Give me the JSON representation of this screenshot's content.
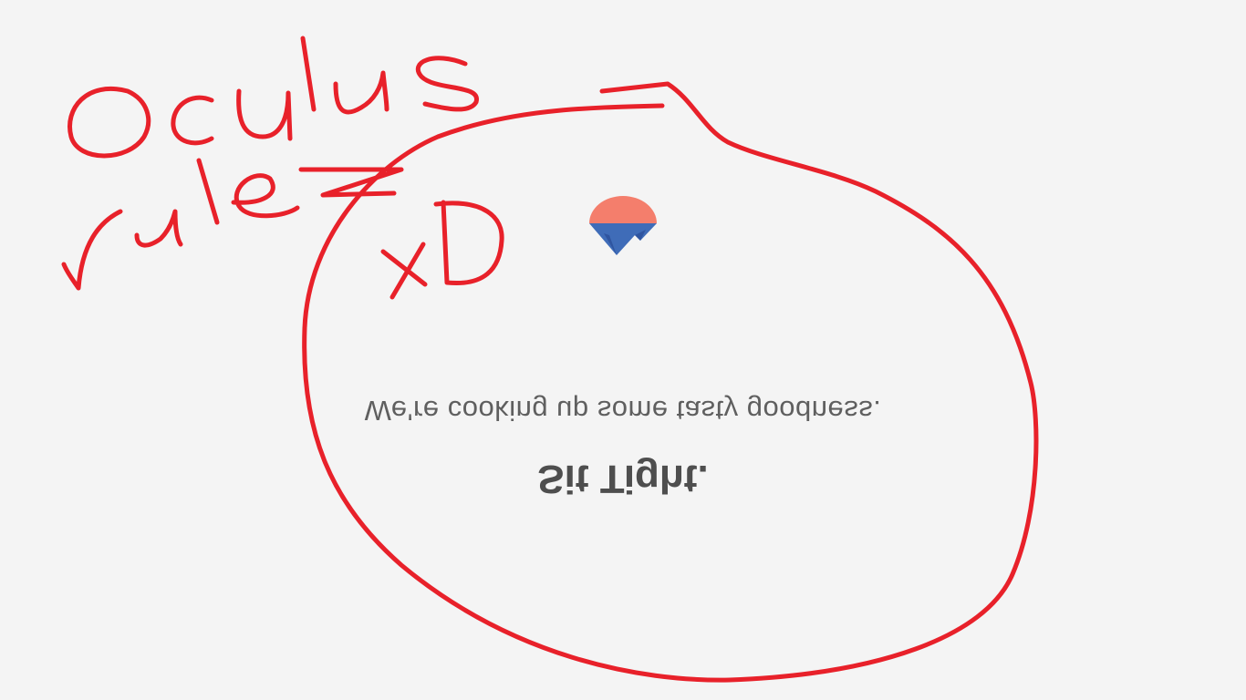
{
  "loading": {
    "tagline": "We're cooking up some tasty goodness.",
    "headline": "Sit Tight."
  },
  "logo": {
    "icon": "gem-logo-icon",
    "colors": {
      "top": "#f47e6c",
      "bottom": "#3f6cb8",
      "shade": "#2f55a0"
    }
  },
  "annotation": {
    "words": [
      "Oculus",
      "rulez",
      "xD"
    ],
    "color": "#e8212a"
  }
}
